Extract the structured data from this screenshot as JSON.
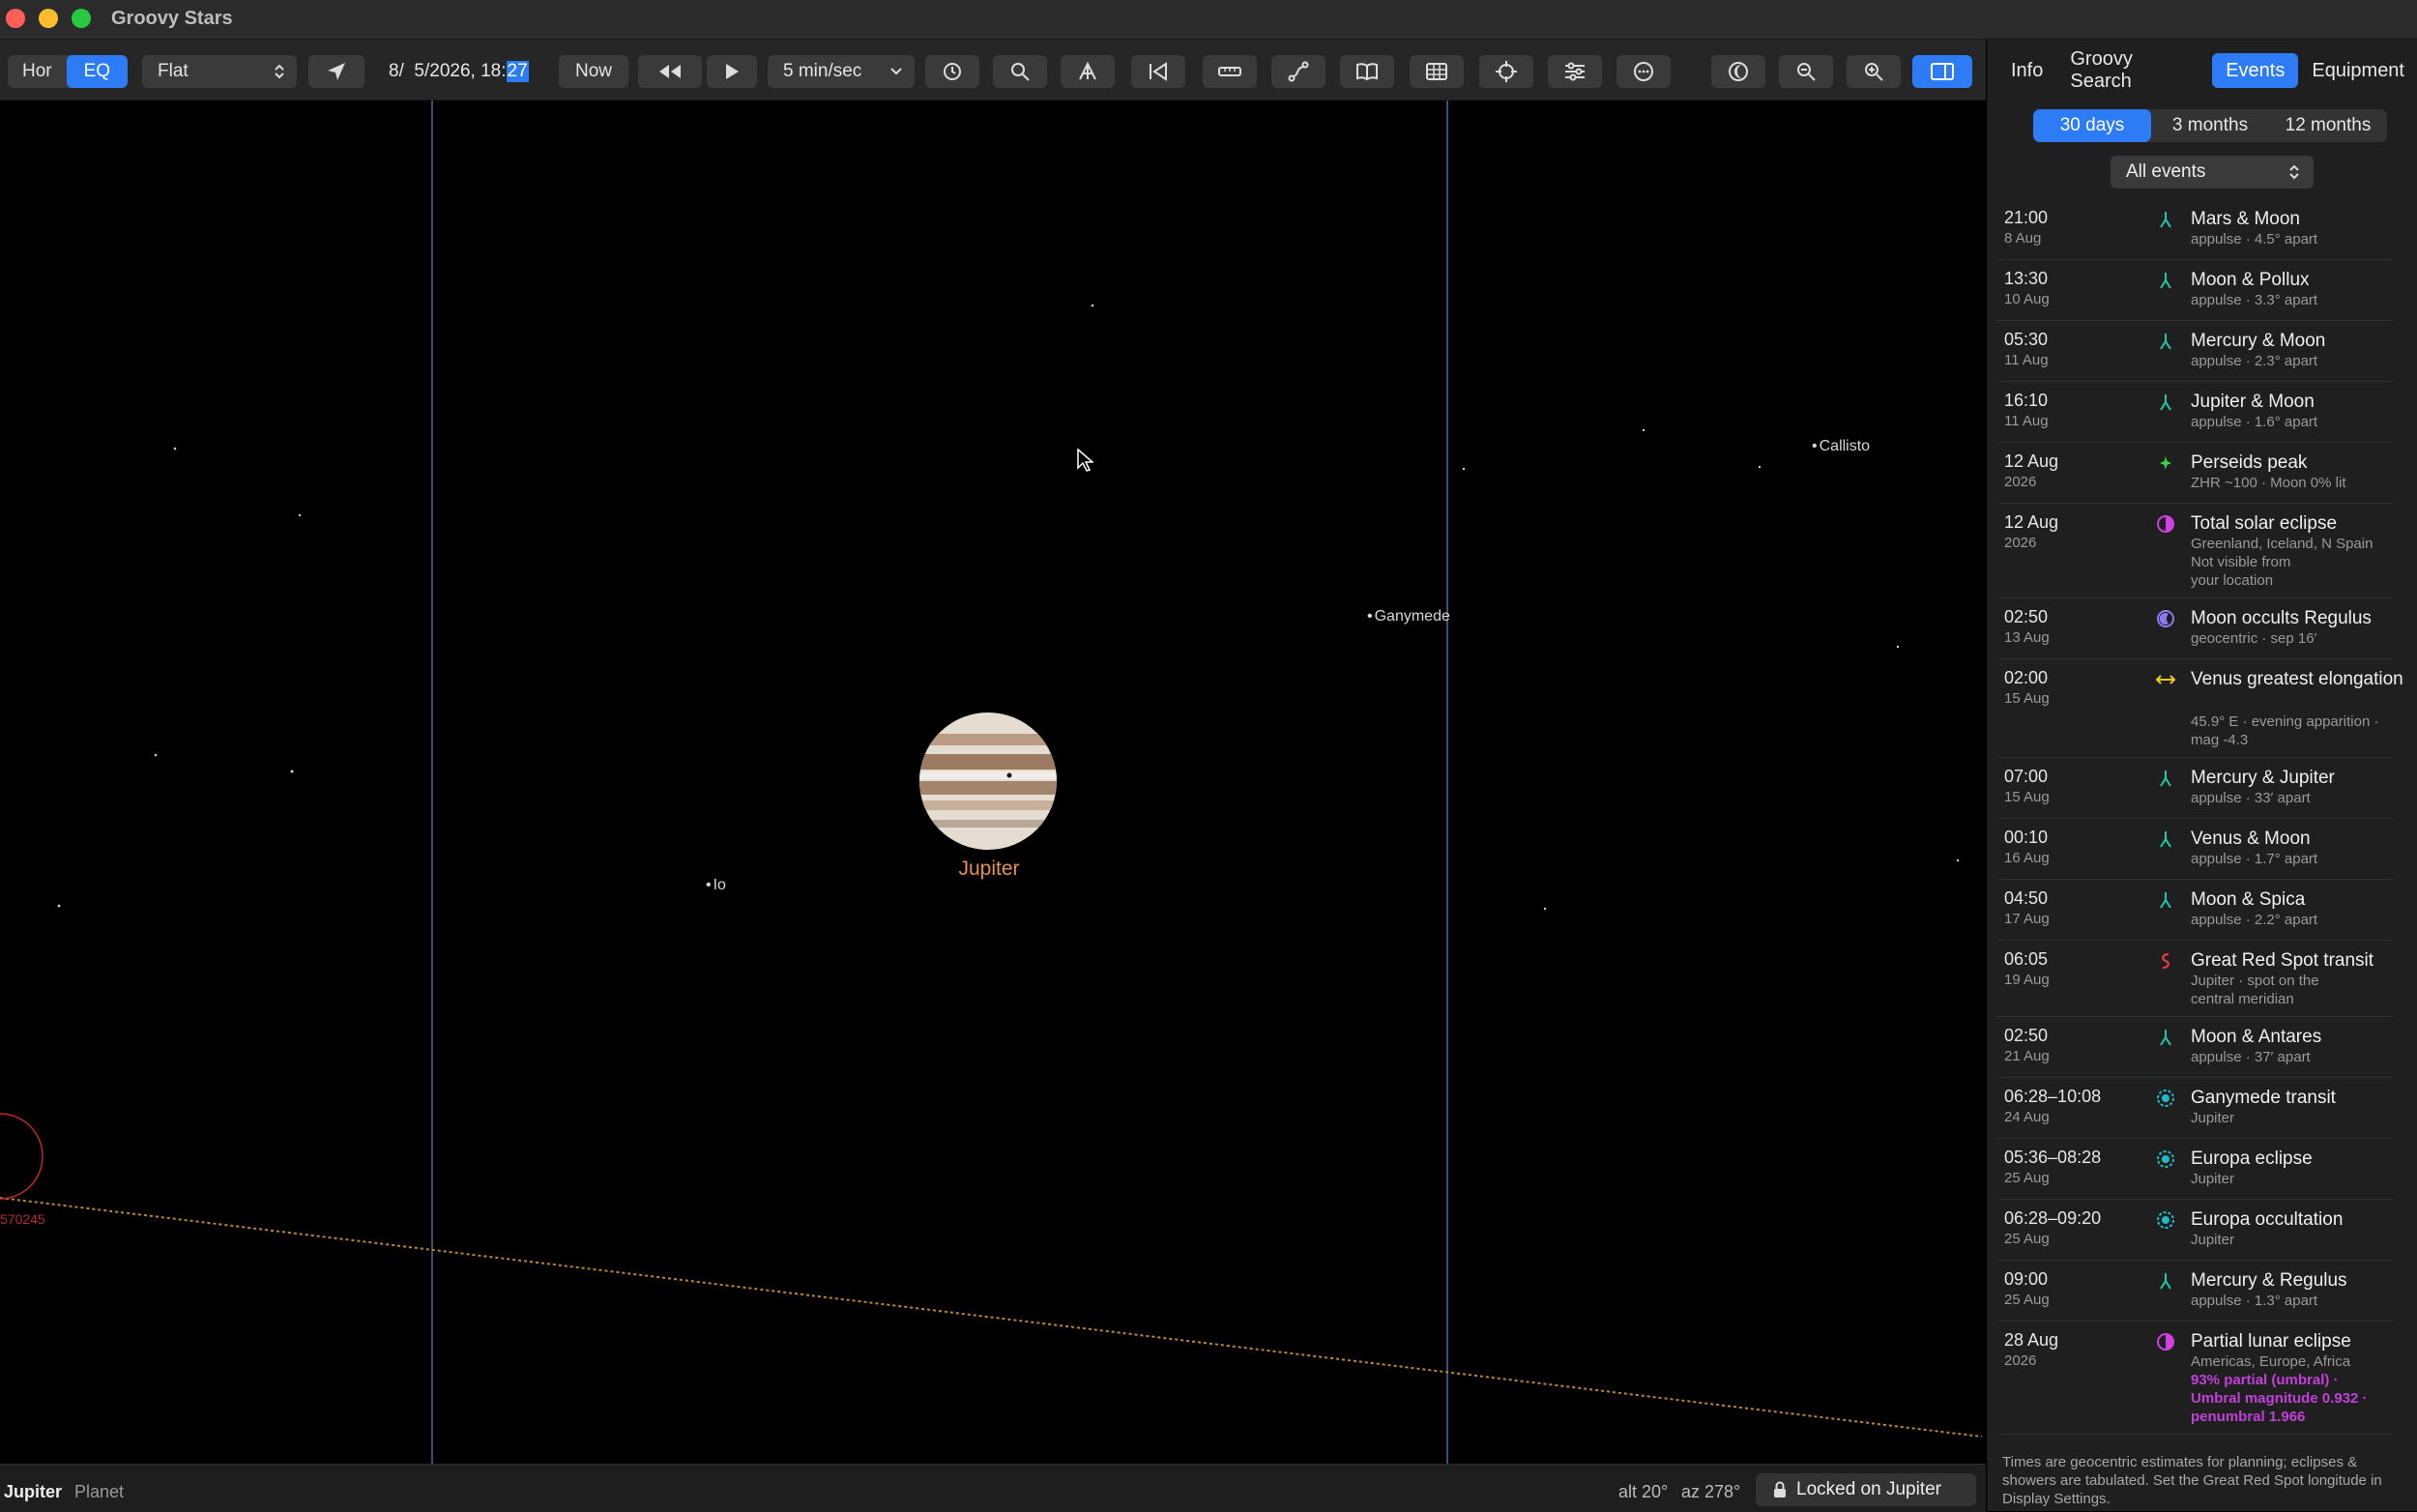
{
  "window": {
    "title": "Groovy Stars"
  },
  "toolbar": {
    "hor": "Hor",
    "eq": "EQ",
    "projection": "Flat",
    "datetime_prefix": "8/  5/2026, 18:",
    "datetime_minutes": "27",
    "now": "Now",
    "speed": "5 min/sec"
  },
  "sky": {
    "planet_label": "Jupiter",
    "moons": {
      "callisto": "Callisto",
      "ganymede": "Ganymede",
      "io": "Io"
    },
    "offscreen_label": "570245"
  },
  "status": {
    "object_name": "Jupiter",
    "object_type": "Planet",
    "alt": "alt 20°",
    "az": "az 278°",
    "lock": "Locked on Jupiter"
  },
  "panel": {
    "tabs": [
      "Info",
      "Groovy Search",
      "Events",
      "Equipment"
    ],
    "active_tab": "Events",
    "ranges": [
      "30 days",
      "3 months",
      "12 months"
    ],
    "filter": "All events",
    "footnote": "Times are geocentric estimates for planning; eclipses & showers are tabulated. Set the Great Red Spot longitude in Display Settings."
  },
  "colors": {
    "accent": "#2d7cf6",
    "conjunction": "#22c7a9",
    "meteor": "#3ad04a",
    "eclipse": "#d040e0",
    "occult": "#8a7cf0",
    "elongation": "#f2c81e",
    "grs": "#e84040",
    "moon_event": "#22b8c8",
    "jupiter_label": "#e8904a"
  },
  "events": [
    {
      "time": "21:00",
      "date": "8 Aug",
      "icon": "conjunction-icon",
      "name": "Mars & Moon",
      "sub": [
        "appulse · 4.5° apart"
      ]
    },
    {
      "time": "13:30",
      "date": "10 Aug",
      "icon": "conjunction-icon",
      "name": "Moon & Pollux",
      "sub": [
        "appulse · 3.3° apart"
      ]
    },
    {
      "time": "05:30",
      "date": "11 Aug",
      "icon": "conjunction-icon",
      "name": "Mercury & Moon",
      "sub": [
        "appulse · 2.3° apart"
      ]
    },
    {
      "time": "16:10",
      "date": "11 Aug",
      "icon": "conjunction-icon",
      "name": "Jupiter & Moon",
      "sub": [
        "appulse · 1.6° apart"
      ]
    },
    {
      "time": "12 Aug",
      "date": "2026",
      "icon": "meteor-icon",
      "name": "Perseids peak",
      "sub": [
        "ZHR ~100 · Moon 0% lit"
      ]
    },
    {
      "time": "12 Aug",
      "date": "2026",
      "icon": "eclipse-icon",
      "name": "Total solar eclipse",
      "sub": [
        "Greenland, Iceland, N Spain",
        "Not visible from",
        "your location"
      ]
    },
    {
      "time": "02:50",
      "date": "13 Aug",
      "icon": "occultation-icon",
      "name": "Moon occults Regulus",
      "sub": [
        "geocentric · sep 16′"
      ]
    },
    {
      "time": "02:00",
      "date": "15 Aug",
      "icon": "elongation-icon",
      "name": "Venus greatest elongation",
      "sub": [
        "45.9° E · evening apparition ·",
        "mag -4.3"
      ]
    },
    {
      "time": "07:00",
      "date": "15 Aug",
      "icon": "conjunction-icon",
      "name": "Mercury & Jupiter",
      "sub": [
        "appulse · 33′ apart"
      ]
    },
    {
      "time": "00:10",
      "date": "16 Aug",
      "icon": "conjunction-icon",
      "name": "Venus & Moon",
      "sub": [
        "appulse · 1.7° apart"
      ]
    },
    {
      "time": "04:50",
      "date": "17 Aug",
      "icon": "conjunction-icon",
      "name": "Moon & Spica",
      "sub": [
        "appulse · 2.2° apart"
      ]
    },
    {
      "time": "06:05",
      "date": "19 Aug",
      "icon": "red-spot-icon",
      "name": "Great Red Spot transit",
      "sub": [
        "Jupiter · spot on the",
        "central meridian"
      ]
    },
    {
      "time": "02:50",
      "date": "21 Aug",
      "icon": "conjunction-icon",
      "name": "Moon & Antares",
      "sub": [
        "appulse · 37′ apart"
      ]
    },
    {
      "time": "06:28–10:08",
      "date": "24 Aug",
      "icon": "jovian-moon-icon",
      "name": "Ganymede transit",
      "sub": [
        "Jupiter"
      ]
    },
    {
      "time": "05:36–08:28",
      "date": "25 Aug",
      "icon": "jovian-moon-icon",
      "name": "Europa eclipse",
      "sub": [
        "Jupiter"
      ]
    },
    {
      "time": "06:28–09:20",
      "date": "25 Aug",
      "icon": "jovian-moon-icon",
      "name": "Europa occultation",
      "sub": [
        "Jupiter"
      ]
    },
    {
      "time": "09:00",
      "date": "25 Aug",
      "icon": "conjunction-icon",
      "name": "Mercury & Regulus",
      "sub": [
        "appulse · 1.3° apart"
      ]
    },
    {
      "time": "28 Aug",
      "date": "2026",
      "icon": "eclipse-icon",
      "name": "Partial lunar eclipse",
      "sub": [
        "Americas, Europe, Africa"
      ],
      "highlight": [
        "93% partial (umbral) ·",
        "Umbral magnitude 0.932 ·",
        "penumbral 1.966"
      ]
    }
  ]
}
